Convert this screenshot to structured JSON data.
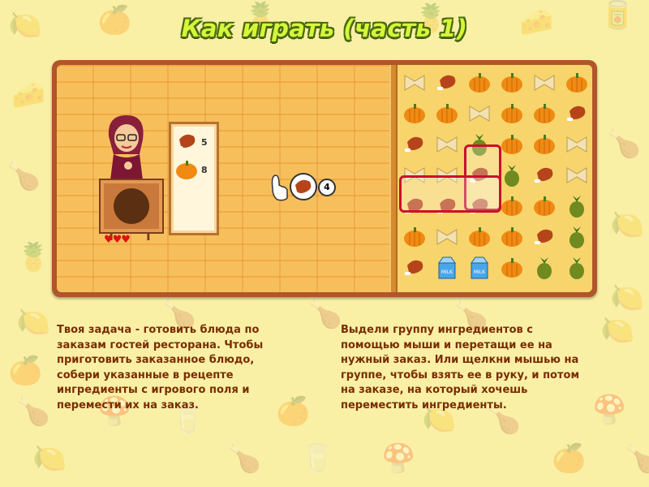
{
  "title": "Как играть (часть 1)",
  "left_text": "Твоя задача - готовить блюда по заказам гостей ресторана. Чтобы приготовить заказанное блюдо, собери указанные в рецепте ингредиенты с игрового поля и перемести их на заказ.",
  "right_text": "Выдели группу ингредиентов с помощью мыши и перетащи ее на нужный заказ. Или щелкни мышью на группе, чтобы взять ее в руку, и потом на заказе, на который хочешь переместить ингредиенты.",
  "order": {
    "items": [
      {
        "icon": "drumstick-icon",
        "count": "5"
      },
      {
        "icon": "pumpkin-icon",
        "count": "8"
      }
    ]
  },
  "hand": {
    "icon": "drumstick-icon",
    "count": "4"
  },
  "chef": {
    "lives": "♥♥♥"
  },
  "board": {
    "rows": [
      [
        "pasta",
        "drumstick",
        "pumpkin",
        "pumpkin",
        "pasta",
        "pumpkin"
      ],
      [
        "pumpkin",
        "pumpkin",
        "pasta",
        "pumpkin",
        "pumpkin",
        "drumstick"
      ],
      [
        "drumstick",
        "pasta",
        "pineapple",
        "pumpkin",
        "pumpkin",
        "pasta"
      ],
      [
        "pasta",
        "pasta",
        "drumstick",
        "pineapple",
        "drumstick",
        "pasta"
      ],
      [
        "drumstick",
        "drumstick",
        "drumstick",
        "pumpkin",
        "pumpkin",
        "pineapple"
      ],
      [
        "pumpkin",
        "pasta",
        "pumpkin",
        "pumpkin",
        "drumstick",
        "pineapple"
      ],
      [
        "drumstick",
        "milk",
        "milk",
        "pumpkin",
        "pineapple",
        "pineapple"
      ]
    ]
  },
  "colors": {
    "accent": "#b0562a",
    "text": "#7a2c00",
    "title": "#d6f63a",
    "selection": "#c8102e"
  }
}
